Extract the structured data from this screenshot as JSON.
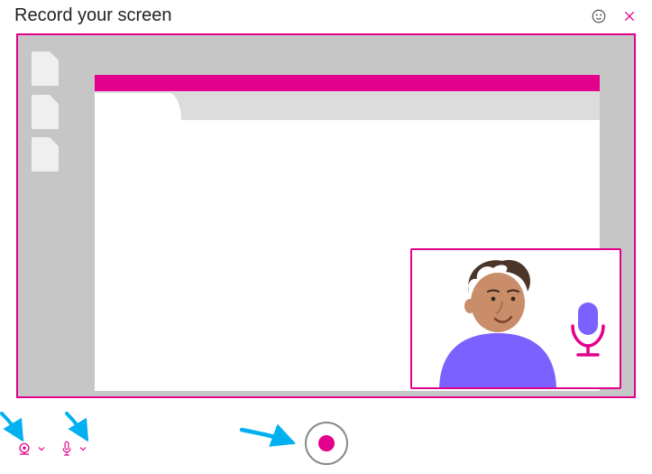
{
  "header": {
    "title": "Record your screen"
  },
  "colors": {
    "accent": "#e3008c",
    "annotation": "#00b0f0"
  },
  "icons": {
    "feedback": "smiley-icon",
    "close": "close-icon",
    "camera": "camera-icon",
    "camera_chevron": "chevron-down-icon",
    "mic": "microphone-icon",
    "mic_chevron": "chevron-down-icon",
    "record": "record-icon"
  }
}
